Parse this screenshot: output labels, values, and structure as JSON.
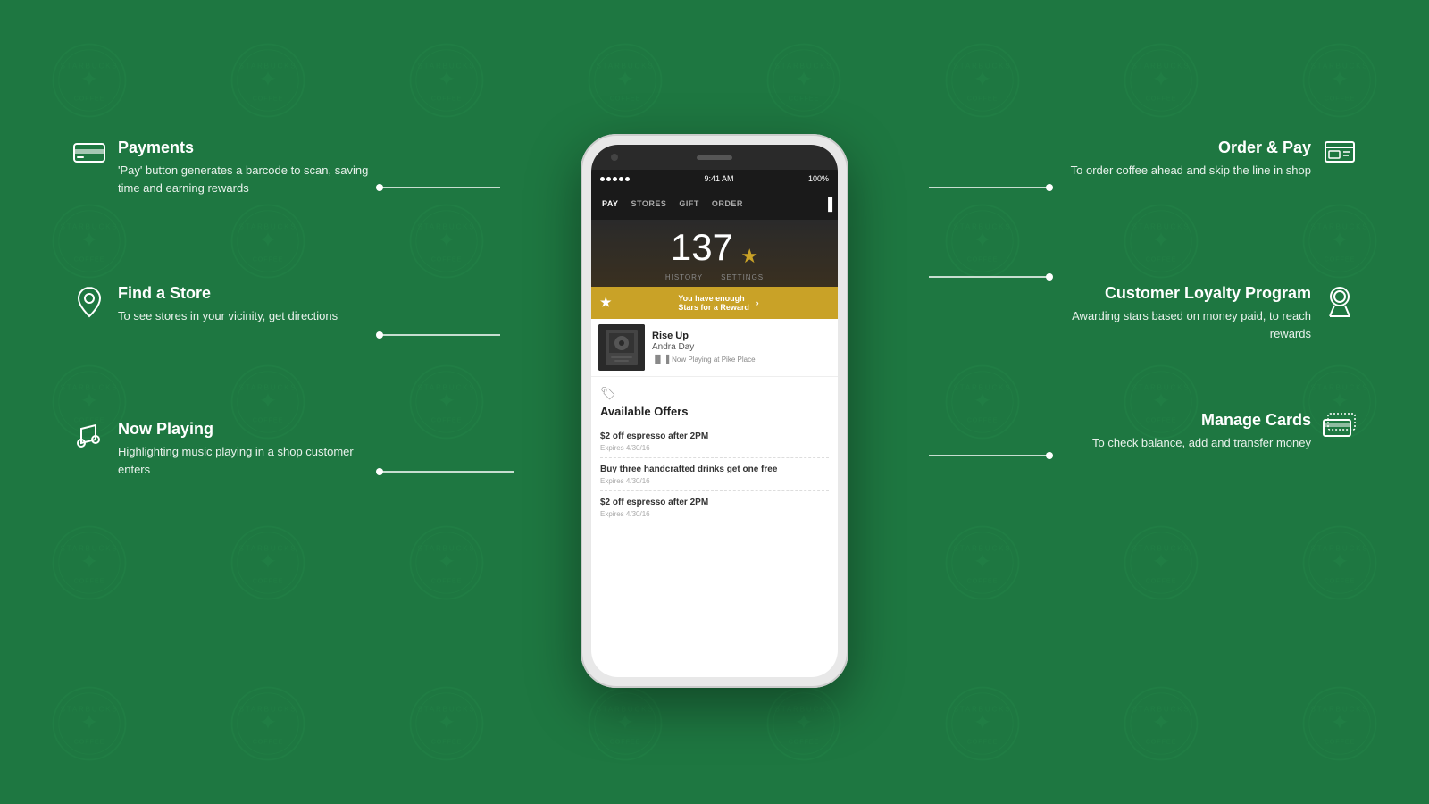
{
  "background": {
    "color": "#1e7741"
  },
  "phone": {
    "status": {
      "dots": 5,
      "time": "9:41 AM",
      "battery": "100%",
      "wifi": "WiFi"
    },
    "nav": {
      "tabs": [
        "PAY",
        "STORES",
        "GIFT",
        "ORDER"
      ]
    },
    "stars": {
      "count": "137",
      "subLabels": [
        "HISTORY",
        "SETTINGS"
      ]
    },
    "reward": {
      "text": "You have enough Stars for a Reward"
    },
    "music": {
      "title": "Rise Up",
      "artist": "Andra Day",
      "nowPlaying": "Now Playing at Pike Place"
    },
    "offers": {
      "title": "Available Offers",
      "items": [
        {
          "text": "$2 off espresso after 2PM",
          "expires": "Expires 4/30/16"
        },
        {
          "text": "Buy three handcrafted drinks get one free",
          "expires": "Expires 4/30/16"
        },
        {
          "text": "$2 off espresso after 2PM",
          "expires": "Expires 4/30/16"
        }
      ]
    }
  },
  "features": {
    "payments": {
      "icon": "💳",
      "title": "Payments",
      "description": "'Pay' button generates a barcode to scan, saving time and earning rewards"
    },
    "findStore": {
      "icon": "📍",
      "title": "Find a Store",
      "description": "To see stores in your vicinity, get directions"
    },
    "nowPlaying": {
      "icon": "♪",
      "title": "Now Playing",
      "description": "Highlighting music playing in a shop customer enters"
    },
    "orderPay": {
      "icon": "🖥",
      "title": "Order & Pay",
      "description": "To order coffee ahead and skip the line in shop"
    },
    "loyalty": {
      "icon": "🎖",
      "title": "Customer Loyalty Program",
      "description": "Awarding stars based on money paid, to reach rewards"
    },
    "manageCards": {
      "icon": "💳",
      "title": "Manage Cards",
      "description": "To check balance, add and transfer money"
    }
  }
}
